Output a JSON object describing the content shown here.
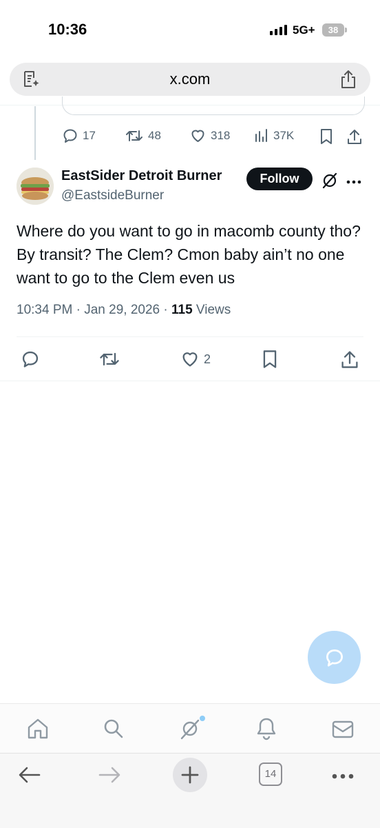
{
  "status_bar": {
    "time": "10:36",
    "network": "5G+",
    "battery": "38"
  },
  "browser": {
    "url": "x.com",
    "tab_count": "14"
  },
  "prev_tweet": {
    "replies": "17",
    "reposts": "48",
    "likes": "318",
    "views": "37K"
  },
  "tweet": {
    "display_name": "EastSider Detroit Burner",
    "handle": "@EastsideBurner",
    "follow_label": "Follow",
    "text": "Where do you want to go in macomb county tho? By transit? The Clem? Cmon baby ain’t no one want to go to the Clem even us",
    "time": "10:34 PM",
    "date": "Jan 29, 2026",
    "views_count": "115",
    "views_label": "Views",
    "likes": "2"
  },
  "colors": {
    "accent": "#1d9bf0",
    "secondary_text": "#536471",
    "fab": "#b9dcf9"
  },
  "bottom_nav": [
    "home-icon",
    "search-icon",
    "grok-icon",
    "notifications-icon",
    "messages-icon"
  ],
  "browser_toolbar": [
    "back-icon",
    "forward-icon",
    "new-tab-icon",
    "tabs-icon",
    "more-icon"
  ]
}
